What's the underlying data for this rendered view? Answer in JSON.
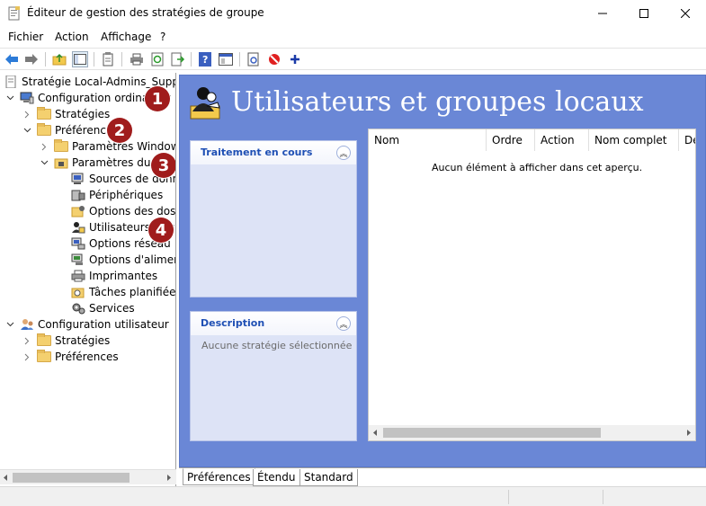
{
  "window": {
    "title": "Éditeur de gestion des stratégies de groupe",
    "minimize_icon": "minimize-icon",
    "maximize_icon": "maximize-icon",
    "close_icon": "close-icon"
  },
  "menu": [
    {
      "label": "Fichier"
    },
    {
      "label": "Action"
    },
    {
      "label": "Affichage"
    },
    {
      "label": "?"
    }
  ],
  "toolbar": [
    "back-icon",
    "forward-icon",
    "up-folder-icon",
    "show-hide-tree-icon",
    "properties-icon",
    "print-icon",
    "refresh-icon",
    "export-icon",
    "help-icon",
    "console-icon",
    "edit-icon",
    "stop-icon",
    "add-icon"
  ],
  "tree": {
    "root": "Stratégie Local-Admins_Suppr [",
    "computer_config": "Configuration ordinateur",
    "strategies_1": "Stratégies",
    "preferences_1": "Préférences",
    "windows_params": "Paramètres Windows",
    "panel_params": "Paramètres du Panneau",
    "data_sources": "Sources de données",
    "devices": "Périphériques",
    "folder_options": "Options des dossiers",
    "local_users": "Utilisateurs et groupes locaux",
    "network_options": "Options réseau",
    "power_options": "Options d'alimentation",
    "printers": "Imprimantes",
    "scheduled_tasks": "Tâches planifiées",
    "services": "Services",
    "user_config": "Configuration utilisateur",
    "strategies_2": "Stratégies",
    "preferences_2": "Préférences"
  },
  "annotations": [
    "1",
    "2",
    "3",
    "4"
  ],
  "content": {
    "heading": "Utilisateurs et groupes locaux",
    "processing_title": "Traitement en cours",
    "description_title": "Description",
    "description_text": "Aucune stratégie sélectionnée",
    "columns": [
      "Nom",
      "Ordre",
      "Action",
      "Nom complet",
      "De"
    ],
    "empty_message": "Aucun élément à afficher dans cet aperçu."
  },
  "tabs": [
    {
      "label": "Préférences",
      "active": true
    },
    {
      "label": "Étendu",
      "active": false
    },
    {
      "label": "Standard",
      "active": false
    }
  ],
  "colors": {
    "right_pane_bg": "#6a87d6",
    "panel_title": "#1e4fb4",
    "badge": "#a01c1c"
  }
}
